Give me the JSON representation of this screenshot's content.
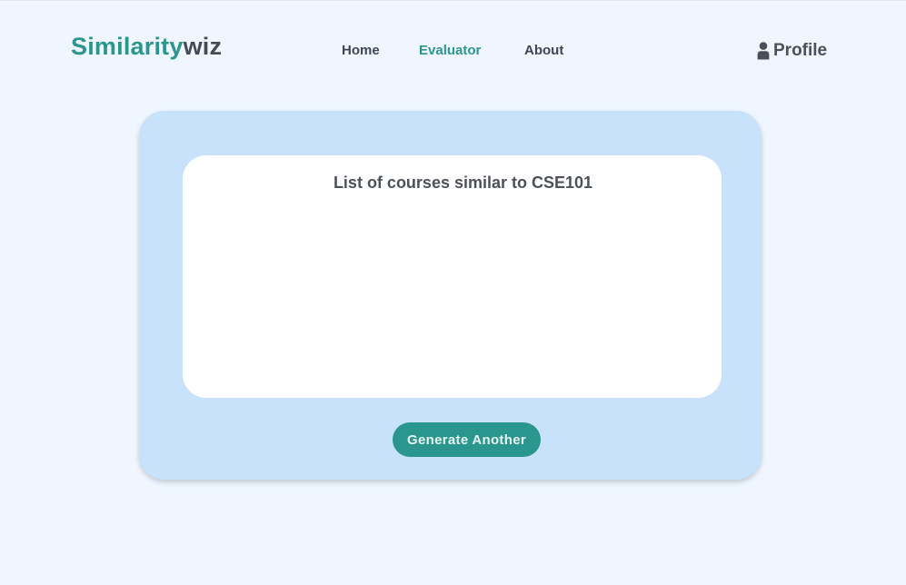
{
  "header": {
    "logo": {
      "part_a": "Similarity",
      "part_b": "wiz"
    },
    "nav": {
      "home": "Home",
      "evaluator": "Evaluator",
      "about": "About",
      "active": "Evaluator"
    },
    "profile": {
      "icon": "user-icon",
      "label": "Profile"
    }
  },
  "main": {
    "results_title": "List of courses similar to CSE101",
    "courses": [],
    "generate_button_label": "Generate Another"
  },
  "colors": {
    "accent": "#2a968d",
    "page_background": "#eff6ff",
    "card_background": "#c7e2fa",
    "panel_background": "#ffffff",
    "text_dark": "#454b52"
  }
}
